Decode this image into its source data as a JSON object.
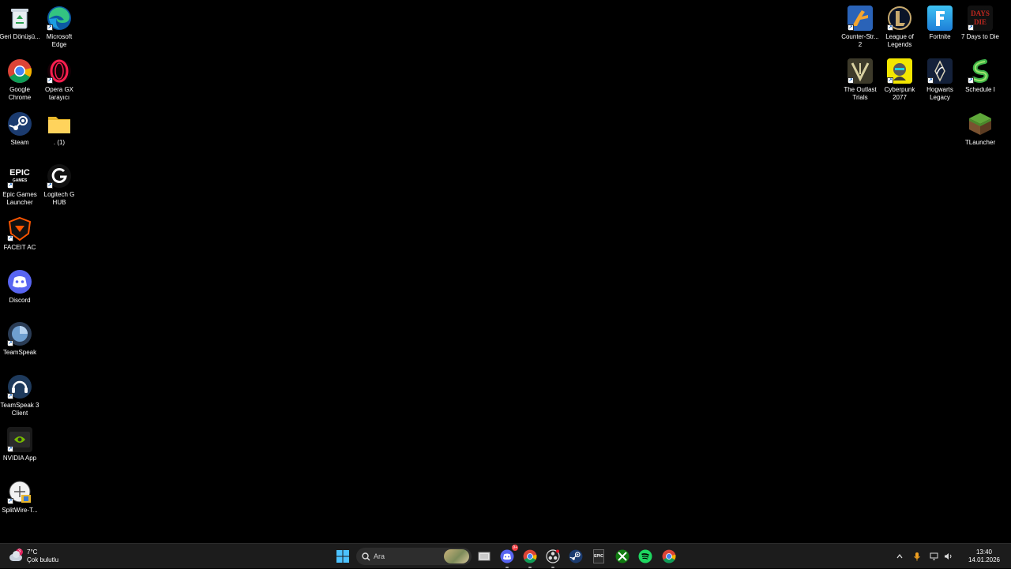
{
  "desktop": {
    "left_icons": [
      {
        "name": "recycle-bin-icon",
        "label": "Geri Dönüşü...",
        "shortcut": false
      },
      {
        "name": "microsoft-edge-icon",
        "label": "Microsoft Edge",
        "shortcut": true
      },
      {
        "name": "google-chrome-icon",
        "label": "Google Chrome",
        "shortcut": false
      },
      {
        "name": "opera-gx-icon",
        "label": "Opera GX tarayıcı",
        "shortcut": true
      },
      {
        "name": "steam-icon",
        "label": "Steam",
        "shortcut": false
      },
      {
        "name": "folder-icon",
        "label": ". (1)",
        "shortcut": false
      },
      {
        "name": "epic-games-icon",
        "label": "Epic Games Launcher",
        "shortcut": true
      },
      {
        "name": "logitech-g-hub-icon",
        "label": "Logitech G HUB",
        "shortcut": true
      },
      {
        "name": "faceit-ac-icon",
        "label": "FACEIT AC",
        "shortcut": true
      },
      {
        "name": "discord-icon",
        "label": "Discord",
        "shortcut": false
      },
      {
        "name": "teamspeak-icon",
        "label": "TeamSpeak",
        "shortcut": true
      },
      {
        "name": "teamspeak-3-client-icon",
        "label": "TeamSpeak 3 Client",
        "shortcut": true
      },
      {
        "name": "nvidia-app-icon",
        "label": "NVIDIA App",
        "shortcut": true
      },
      {
        "name": "splitwire-icon",
        "label": "SplitWire-T...",
        "shortcut": true
      }
    ],
    "right_icons": [
      {
        "name": "counter-strike-2-icon",
        "label": "Counter-Str... 2",
        "shortcut": true
      },
      {
        "name": "league-of-legends-icon",
        "label": "League of Legends",
        "shortcut": true
      },
      {
        "name": "fortnite-icon",
        "label": "Fortnite",
        "shortcut": false
      },
      {
        "name": "7-days-to-die-icon",
        "label": "7 Days to Die",
        "shortcut": true
      },
      {
        "name": "the-outlast-trials-icon",
        "label": "The Outlast Trials",
        "shortcut": true
      },
      {
        "name": "cyberpunk-2077-icon",
        "label": "Cyberpunk 2077",
        "shortcut": true
      },
      {
        "name": "hogwarts-legacy-icon",
        "label": "Hogwarts Legacy",
        "shortcut": true
      },
      {
        "name": "schedule-1-icon",
        "label": "Schedule I",
        "shortcut": true
      },
      {
        "name": "tlauncher-icon",
        "label": "TLauncher",
        "shortcut": false
      }
    ]
  },
  "taskbar": {
    "weather": {
      "temp": "7°C",
      "condition": "Çok bulutlu",
      "badge": "3"
    },
    "search": {
      "placeholder": "Ara"
    },
    "apps": [
      {
        "name": "start-button",
        "icon": "windows-icon"
      },
      {
        "name": "task-view-button",
        "icon": "task-view-icon"
      },
      {
        "name": "discord-taskbar",
        "icon": "discord-icon",
        "badge": "9+"
      },
      {
        "name": "chrome-taskbar",
        "icon": "chrome-icon"
      },
      {
        "name": "obs-taskbar",
        "icon": "obs-icon"
      },
      {
        "name": "steam-taskbar",
        "icon": "steam-icon"
      },
      {
        "name": "epic-taskbar",
        "icon": "epic-games-icon",
        "label": "EPIC"
      },
      {
        "name": "xbox-taskbar",
        "icon": "xbox-icon"
      },
      {
        "name": "spotify-taskbar",
        "icon": "spotify-icon"
      },
      {
        "name": "chrome2-taskbar",
        "icon": "chrome-icon"
      }
    ],
    "clock": {
      "time": "13:40",
      "date": "14.01.2026"
    }
  }
}
